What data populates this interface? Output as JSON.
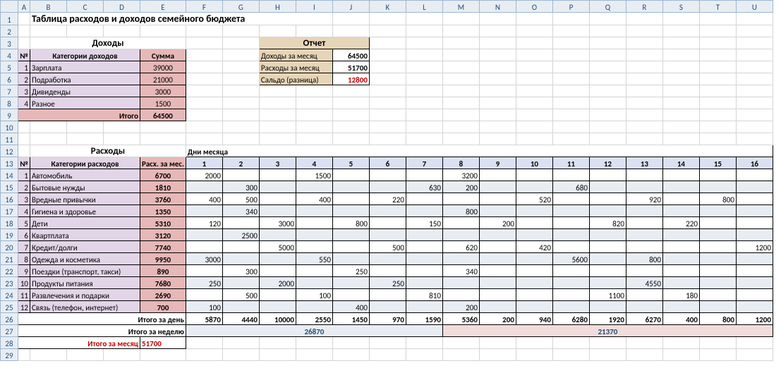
{
  "cols": [
    "",
    "A",
    "B",
    "C",
    "D",
    "E",
    "F",
    "G",
    "H",
    "I",
    "J",
    "K",
    "L",
    "M",
    "N",
    "O",
    "P",
    "Q",
    "R",
    "S",
    "T",
    "U"
  ],
  "title": "Таблица расходов и доходов семейного бюджета",
  "income": {
    "header": "Доходы",
    "cols": {
      "num": "№",
      "cat": "Категории доходов",
      "sum": "Сумма"
    },
    "rows": [
      {
        "n": "1",
        "cat": "Зарплата",
        "sum": "39000"
      },
      {
        "n": "2",
        "cat": "Подработка",
        "sum": "21000"
      },
      {
        "n": "3",
        "cat": "Дивиденды",
        "sum": "3000"
      },
      {
        "n": "4",
        "cat": "Разное",
        "sum": "1500"
      }
    ],
    "total_lbl": "Итого",
    "total": "64500"
  },
  "report": {
    "header": "Отчет",
    "rows": [
      {
        "lbl": "Доходы за месяц",
        "val": "64500"
      },
      {
        "lbl": "Расходы за месяц",
        "val": "51700"
      },
      {
        "lbl": "Сальдо (разница)",
        "val": "12800",
        "red": true
      }
    ]
  },
  "expenses": {
    "header": "Расходы",
    "days_lbl": "Дни месяца",
    "cols": {
      "num": "№",
      "cat": "Категории расходов",
      "sum": "Расх. за мес."
    },
    "days": [
      "1",
      "2",
      "3",
      "4",
      "5",
      "6",
      "7",
      "8",
      "9",
      "10",
      "11",
      "12",
      "13",
      "14",
      "15",
      "16"
    ],
    "rows": [
      {
        "n": "1",
        "cat": "Автомобиль",
        "sum": "6700",
        "d": [
          "2000",
          "",
          "",
          "1500",
          "",
          "",
          "",
          "3200",
          "",
          "",
          "",
          "",
          "",
          "",
          "",
          ""
        ]
      },
      {
        "n": "2",
        "cat": "Бытовые нужды",
        "sum": "1810",
        "d": [
          "",
          "300",
          "",
          "",
          "",
          "",
          "630",
          "200",
          "",
          "",
          "680",
          "",
          "",
          "",
          "",
          ""
        ]
      },
      {
        "n": "3",
        "cat": "Вредные привычки",
        "sum": "3760",
        "d": [
          "400",
          "500",
          "",
          "400",
          "",
          "220",
          "",
          "",
          "",
          "520",
          "",
          "",
          "920",
          "",
          "800",
          ""
        ]
      },
      {
        "n": "4",
        "cat": "Гигиена и здоровье",
        "sum": "1350",
        "d": [
          "",
          "340",
          "",
          "",
          "",
          "",
          "",
          "800",
          "",
          "",
          "",
          "",
          "",
          "",
          "",
          ""
        ]
      },
      {
        "n": "5",
        "cat": "Дети",
        "sum": "5310",
        "d": [
          "120",
          "",
          "3000",
          "",
          "800",
          "",
          "150",
          "",
          "200",
          "",
          "",
          "820",
          "",
          "220",
          "",
          ""
        ]
      },
      {
        "n": "6",
        "cat": "Квартплата",
        "sum": "3120",
        "d": [
          "",
          "2500",
          "",
          "",
          "",
          "",
          "",
          "",
          "",
          "",
          "",
          "",
          "",
          "",
          "",
          ""
        ]
      },
      {
        "n": "7",
        "cat": "Кредит/долги",
        "sum": "7740",
        "d": [
          "",
          "",
          "5000",
          "",
          "",
          "500",
          "",
          "620",
          "",
          "420",
          "",
          "",
          "",
          "",
          "",
          "1200"
        ]
      },
      {
        "n": "8",
        "cat": "Одежда и косметика",
        "sum": "9950",
        "d": [
          "3000",
          "",
          "",
          "550",
          "",
          "",
          "",
          "",
          "",
          "",
          "5600",
          "",
          "800",
          "",
          "",
          ""
        ]
      },
      {
        "n": "9",
        "cat": "Поездки (транспорт, такси)",
        "sum": "890",
        "d": [
          "",
          "300",
          "",
          "",
          "250",
          "",
          "",
          "340",
          "",
          "",
          "",
          "",
          "",
          "",
          "",
          ""
        ]
      },
      {
        "n": "10",
        "cat": "Продукты питания",
        "sum": "7680",
        "d": [
          "250",
          "",
          "2000",
          "",
          "",
          "250",
          "",
          "",
          "",
          "",
          "",
          "",
          "4550",
          "",
          "",
          ""
        ]
      },
      {
        "n": "11",
        "cat": "Развлечения и подарки",
        "sum": "2690",
        "d": [
          "",
          "500",
          "",
          "100",
          "",
          "",
          "810",
          "",
          "",
          "",
          "",
          "1100",
          "",
          "180",
          "",
          ""
        ]
      },
      {
        "n": "12",
        "cat": "Связь (телефон, интернет)",
        "sum": "700",
        "d": [
          "100",
          "",
          "",
          "",
          "400",
          "",
          "",
          "200",
          "",
          "",
          "",
          "",
          "",
          "",
          "",
          ""
        ]
      }
    ],
    "daytot_lbl": "Итого за день",
    "daytot": [
      "5870",
      "4440",
      "10000",
      "2550",
      "1450",
      "970",
      "1590",
      "5360",
      "200",
      "940",
      "6280",
      "1920",
      "6270",
      "400",
      "800",
      "1200"
    ],
    "week_lbl": "Итого за неделю",
    "week1": "26870",
    "week2": "21370",
    "month_lbl": "Итого за месяц",
    "month": "51700"
  }
}
